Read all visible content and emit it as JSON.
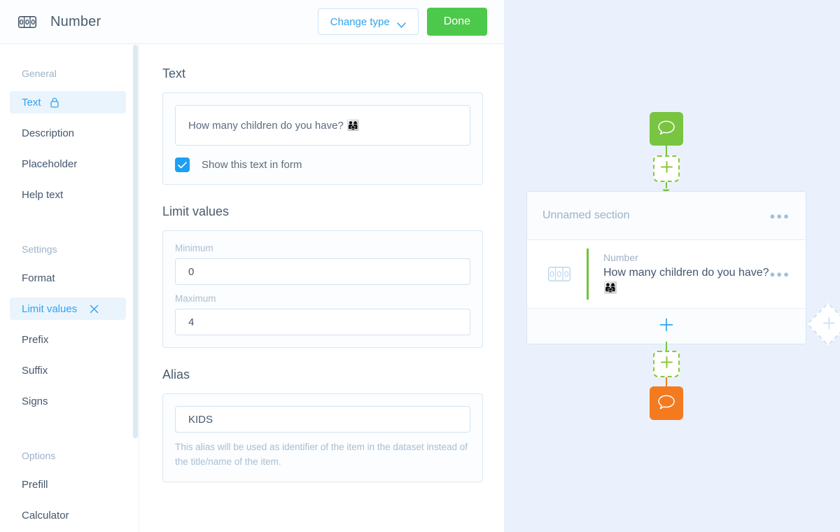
{
  "topbar": {
    "icon": "number-field-icon",
    "title": "Number",
    "change_type_label": "Change type",
    "change_type_icon": "chevron-down-icon",
    "done_label": "Done",
    "done_color": "#4CC94A",
    "accent_color": "#2fa3f0"
  },
  "sidebar": {
    "groups": [
      {
        "label": "General",
        "items": [
          {
            "label": "Text",
            "active": true,
            "icon": "lock-icon"
          },
          {
            "label": "Description",
            "active": false,
            "icon": ""
          },
          {
            "label": "Placeholder",
            "active": false,
            "icon": ""
          },
          {
            "label": "Help text",
            "active": false,
            "icon": ""
          }
        ]
      },
      {
        "label": "Settings",
        "items": [
          {
            "label": "Format",
            "active": false,
            "icon": ""
          },
          {
            "label": "Limit values",
            "active": true,
            "icon": "close-icon"
          },
          {
            "label": "Prefix",
            "active": false,
            "icon": ""
          },
          {
            "label": "Suffix",
            "active": false,
            "icon": ""
          },
          {
            "label": "Signs",
            "active": false,
            "icon": ""
          }
        ]
      },
      {
        "label": "Options",
        "items": [
          {
            "label": "Prefill",
            "active": false,
            "icon": ""
          },
          {
            "label": "Calculator",
            "active": false,
            "icon": ""
          }
        ]
      }
    ]
  },
  "content": {
    "text_section": {
      "title": "Text",
      "value": "How many children do you have? 👨‍👩‍👧",
      "checkbox_label": "Show this text in form",
      "checkbox_checked": true
    },
    "limit_section": {
      "title": "Limit values",
      "minimum_label": "Minimum",
      "minimum_value": "0",
      "maximum_label": "Maximum",
      "maximum_value": "4"
    },
    "alias_section": {
      "title": "Alias",
      "value": "KIDS",
      "hint": "This alias will be used as identifier of the item in the dataset instead of the title/name of the item."
    }
  },
  "preview": {
    "background": "#eaf1fc",
    "start_node": {
      "icon": "speech-bubble-icon",
      "color": "#79c441"
    },
    "end_node": {
      "icon": "speech-bubble-icon",
      "color": "#f47a20"
    },
    "add_node_icon": "plus-icon",
    "section": {
      "name": "Unnamed section",
      "menu_icon": "more-options-icon",
      "item": {
        "kind": "Number",
        "title": "How many children do you have? 👨‍👩‍👧",
        "icon": "number-field-icon",
        "menu_icon": "more-options-icon",
        "accent": "#6fc33c"
      },
      "add_item_icon": "plus-icon"
    },
    "branch_add_icon": "plus-icon"
  }
}
